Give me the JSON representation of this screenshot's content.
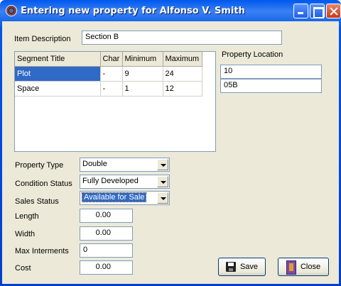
{
  "window": {
    "title": "Entering new property for Alfonso V. Smith"
  },
  "item_description": {
    "label": "Item Description",
    "value": "Section B"
  },
  "grid": {
    "columns": [
      "Segment Title",
      "Char",
      "Minimum",
      "Maximum"
    ],
    "rows": [
      {
        "title": "Plot",
        "char": "-",
        "minimum": "9",
        "maximum": "24"
      },
      {
        "title": "Space",
        "char": "-",
        "minimum": "1",
        "maximum": "12"
      }
    ]
  },
  "property_location": {
    "label": "Property Location",
    "values": [
      "10",
      "05B"
    ]
  },
  "property_type": {
    "label": "Property Type",
    "value": "Double"
  },
  "condition_status": {
    "label": "Condition Status",
    "value": "Fully Developed"
  },
  "sales_status": {
    "label": "Sales Status",
    "value": "Available for Sale"
  },
  "length": {
    "label": "Length",
    "value": "0.00"
  },
  "width": {
    "label": "Width",
    "value": "0.00"
  },
  "max_interments": {
    "label": "Max Interments",
    "value": "0"
  },
  "cost": {
    "label": "Cost",
    "value": "0.00"
  },
  "buttons": {
    "save": "Save",
    "close": "Close"
  }
}
